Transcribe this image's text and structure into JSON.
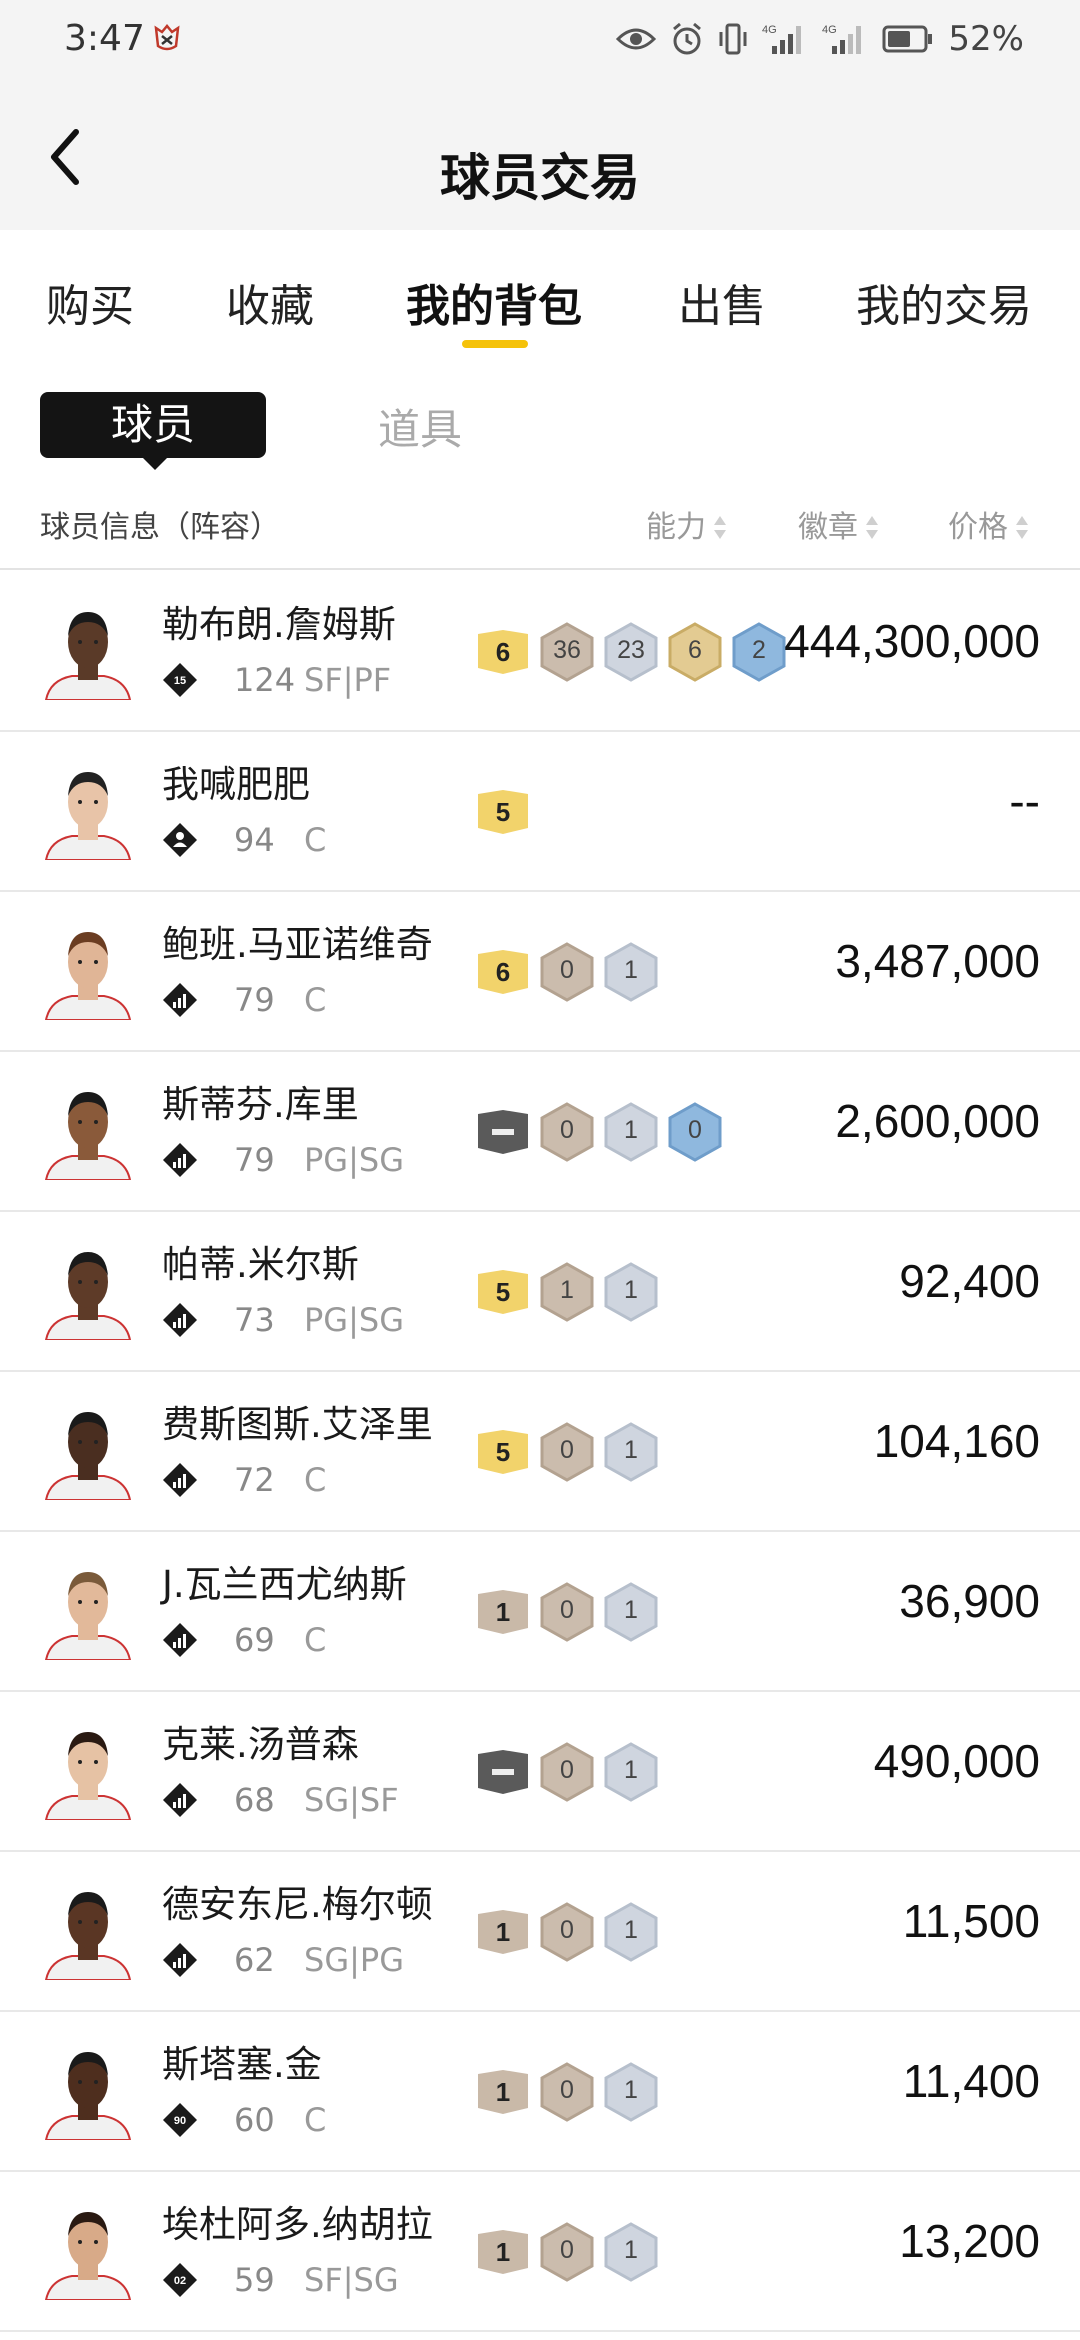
{
  "status": {
    "time": "3:47",
    "network_1": "4G",
    "network_2": "4G",
    "battery": "52%"
  },
  "header": {
    "title": "球员交易"
  },
  "tabs": [
    {
      "label": "购买",
      "active": false
    },
    {
      "label": "收藏",
      "active": false
    },
    {
      "label": "我的背包",
      "active": true
    },
    {
      "label": "出售",
      "active": false
    },
    {
      "label": "我的交易",
      "active": false
    }
  ],
  "subtabs": {
    "active": "球员",
    "other": "道具"
  },
  "columns": {
    "info": "球员信息（阵容）",
    "ability": "能力",
    "badge": "徽章",
    "price": "价格"
  },
  "colors": {
    "accent": "#f5c20a",
    "tier_gold": "#f2d36b",
    "tier_bronze": "#c7b7a6",
    "tier_dark": "#555555",
    "hex_bronze": "#c9b8a6",
    "hex_silver": "#c9d0dc",
    "hex_gold": "#e2c98f",
    "hex_blue": "#8db6dc"
  },
  "players": [
    {
      "name": "勒布朗.詹姆斯",
      "icon": "jersey-number-icon",
      "icon_text": "15",
      "ovr": "124",
      "pos": "SF|PF",
      "tier": "6",
      "tier_style": "gold",
      "badges": [
        {
          "v": "36",
          "c": "bronze"
        },
        {
          "v": "23",
          "c": "silver"
        },
        {
          "v": "6",
          "c": "gold"
        },
        {
          "v": "2",
          "c": "blue"
        }
      ],
      "price": "444,300,000",
      "skin": "#5a3a28",
      "hair": "#1a1a1a"
    },
    {
      "name": "我喊肥肥",
      "icon": "person-icon",
      "icon_text": "",
      "ovr": "94",
      "pos": "C",
      "tier": "5",
      "tier_style": "gold",
      "badges": [],
      "price": "--",
      "skin": "#e8c4a8",
      "hair": "#222"
    },
    {
      "name": "鲍班.马亚诺维奇",
      "icon": "signal-bars-icon",
      "icon_text": "",
      "ovr": "79",
      "pos": "C",
      "tier": "6",
      "tier_style": "gold",
      "badges": [
        {
          "v": "0",
          "c": "bronze"
        },
        {
          "v": "1",
          "c": "silver"
        }
      ],
      "price": "3,487,000",
      "skin": "#e0b596",
      "hair": "#6b3d22"
    },
    {
      "name": "斯蒂芬.库里",
      "icon": "signal-bars-icon",
      "icon_text": "",
      "ovr": "79",
      "pos": "PG|SG",
      "tier": "",
      "tier_style": "dark",
      "badges": [
        {
          "v": "0",
          "c": "bronze"
        },
        {
          "v": "1",
          "c": "silver"
        },
        {
          "v": "0",
          "c": "blue"
        }
      ],
      "price": "2,600,000",
      "skin": "#8a5a3a",
      "hair": "#1a1a1a"
    },
    {
      "name": "帕蒂.米尔斯",
      "icon": "signal-bars-icon",
      "icon_text": "",
      "ovr": "73",
      "pos": "PG|SG",
      "tier": "5",
      "tier_style": "gold",
      "badges": [
        {
          "v": "1",
          "c": "bronze"
        },
        {
          "v": "1",
          "c": "silver"
        }
      ],
      "price": "92,400",
      "skin": "#5e3b28",
      "hair": "#1a1a1a"
    },
    {
      "name": "费斯图斯.艾泽里",
      "icon": "signal-bars-icon",
      "icon_text": "",
      "ovr": "72",
      "pos": "C",
      "tier": "5",
      "tier_style": "gold",
      "badges": [
        {
          "v": "0",
          "c": "bronze"
        },
        {
          "v": "1",
          "c": "silver"
        }
      ],
      "price": "104,160",
      "skin": "#4a2e20",
      "hair": "#1a1a1a"
    },
    {
      "name": "J.瓦兰西尤纳斯",
      "icon": "signal-bars-icon",
      "icon_text": "",
      "ovr": "69",
      "pos": "C",
      "tier": "1",
      "tier_style": "bronze",
      "badges": [
        {
          "v": "0",
          "c": "bronze"
        },
        {
          "v": "1",
          "c": "silver"
        }
      ],
      "price": "36,900",
      "skin": "#e2b99a",
      "hair": "#7a5a3a"
    },
    {
      "name": "克莱.汤普森",
      "icon": "signal-bars-icon",
      "icon_text": "",
      "ovr": "68",
      "pos": "SG|SF",
      "tier": "",
      "tier_style": "dark",
      "badges": [
        {
          "v": "0",
          "c": "bronze"
        },
        {
          "v": "1",
          "c": "silver"
        }
      ],
      "price": "490,000",
      "skin": "#e6c2a4",
      "hair": "#2a1a12"
    },
    {
      "name": "德安东尼.梅尔顿",
      "icon": "signal-bars-icon",
      "icon_text": "",
      "ovr": "62",
      "pos": "SG|PG",
      "tier": "1",
      "tier_style": "bronze",
      "badges": [
        {
          "v": "0",
          "c": "bronze"
        },
        {
          "v": "1",
          "c": "silver"
        }
      ],
      "price": "11,500",
      "skin": "#5a3624",
      "hair": "#1a1a1a"
    },
    {
      "name": "斯塔塞.金",
      "icon": "jersey-number-icon",
      "icon_text": "90",
      "ovr": "60",
      "pos": "C",
      "tier": "1",
      "tier_style": "bronze",
      "badges": [
        {
          "v": "0",
          "c": "bronze"
        },
        {
          "v": "1",
          "c": "silver"
        }
      ],
      "price": "11,400",
      "skin": "#4e2e1e",
      "hair": "#1a1a1a"
    },
    {
      "name": "埃杜阿多.纳胡拉",
      "icon": "jersey-number-icon",
      "icon_text": "02",
      "ovr": "59",
      "pos": "SF|SG",
      "tier": "1",
      "tier_style": "bronze",
      "badges": [
        {
          "v": "0",
          "c": "bronze"
        },
        {
          "v": "1",
          "c": "silver"
        }
      ],
      "price": "13,200",
      "skin": "#d8aa88",
      "hair": "#2a1a12"
    }
  ]
}
